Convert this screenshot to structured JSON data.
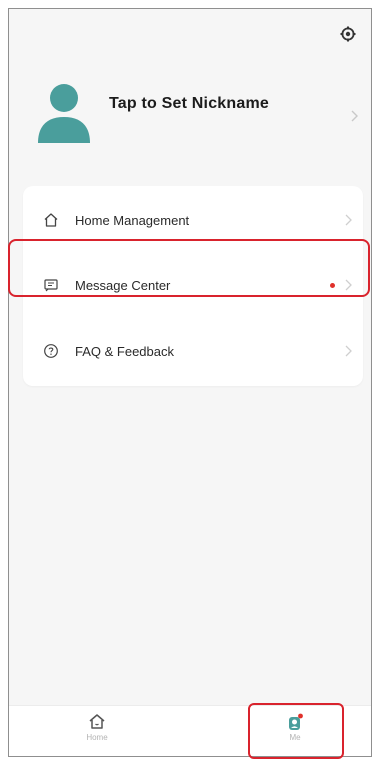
{
  "profile": {
    "nickname_prompt": "Tap to Set Nickname"
  },
  "menu": {
    "items": [
      {
        "label": "Home Management",
        "icon": "home-icon"
      },
      {
        "label": "Message Center",
        "icon": "message-icon",
        "unread": true
      },
      {
        "label": "FAQ & Feedback",
        "icon": "help-icon"
      }
    ]
  },
  "tabbar": {
    "tabs": [
      {
        "label": "Home",
        "icon": "home-tab-icon",
        "active": false
      },
      {
        "label": "Me",
        "icon": "me-tab-icon",
        "active": true,
        "badge": true
      }
    ]
  },
  "colors": {
    "accent": "#4a9e9c",
    "highlight": "#d9232d",
    "unread_dot": "#e0312b"
  }
}
